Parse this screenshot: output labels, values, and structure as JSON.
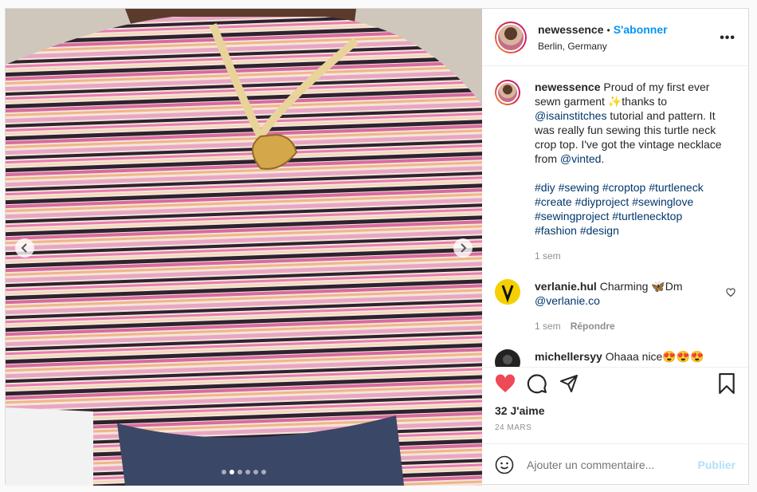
{
  "header": {
    "username": "newessence",
    "separator": "•",
    "follow_label": "S'abonner",
    "location": "Berlin, Germany",
    "more_label": "•••"
  },
  "caption": {
    "username": "newessence",
    "text1": "Proud of my first ever sewn garment ✨thanks to",
    "mention1": "@isainstitches",
    "text2": "tutorial and pattern. It was really fun sewing this turtle neck crop top. I've got the vintage necklace from",
    "mention2": "@vinted",
    "text3": ".",
    "hashtags": [
      "#diy",
      "#sewing",
      "#croptop",
      "#turtleneck",
      "#create",
      "#diyproject",
      "#sewinglove",
      "#sewingproject",
      "#turtlenecktop",
      "#fashion",
      "#design"
    ],
    "time": "1 sem"
  },
  "comments": [
    {
      "username": "verlanie.hul",
      "text_before": "Charming 🦋Dm",
      "mention": "@verlanie.co",
      "time": "1 sem",
      "reply_label": "Répondre"
    },
    {
      "username": "michellersyy",
      "text": "Ohaaa nice😍😍😍"
    }
  ],
  "likes": "32 J'aime",
  "date": "24 MARS",
  "add_comment": {
    "placeholder": "Ajouter un commentaire...",
    "publish_label": "Publier"
  },
  "carousel": {
    "total": 6,
    "active": 1
  },
  "colors": {
    "accent": "#0095f6",
    "like": "#ed4956",
    "link": "#00376b"
  }
}
